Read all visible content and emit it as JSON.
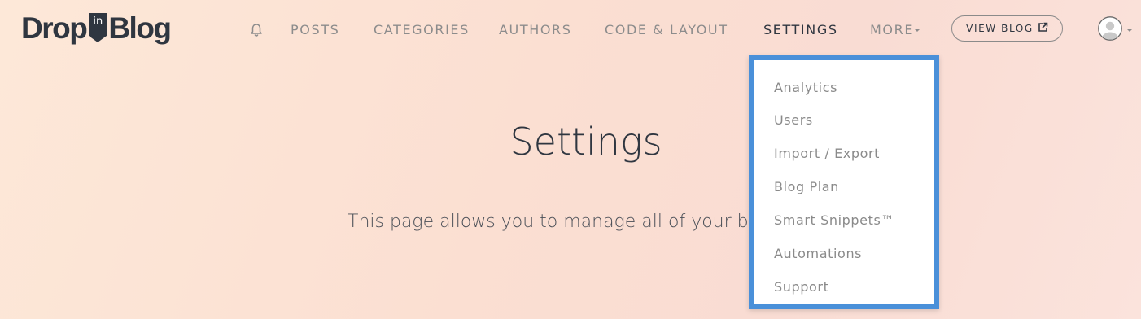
{
  "logo": {
    "part1": "Drop",
    "badge": "in",
    "part2": "Blog"
  },
  "nav": {
    "bell_icon": "bell-icon",
    "items": [
      {
        "label": "POSTS"
      },
      {
        "label": "CATEGORIES"
      },
      {
        "label": "AUTHORS"
      },
      {
        "label": "CODE & LAYOUT"
      },
      {
        "label": "SETTINGS",
        "active": true
      },
      {
        "label": "MORE"
      }
    ],
    "view_blog": "VIEW BLOG",
    "external_link_icon": "external-link-icon",
    "avatar_icon": "user-avatar-icon"
  },
  "main": {
    "title": "Settings",
    "description": "This page allows you to manage all of your blog"
  },
  "dropdown": {
    "items": [
      {
        "label": "Analytics"
      },
      {
        "label": "Users"
      },
      {
        "label": "Import / Export"
      },
      {
        "label": "Blog Plan"
      },
      {
        "label": "Smart Snippets™"
      },
      {
        "label": "Automations"
      },
      {
        "label": "Support"
      }
    ]
  },
  "colors": {
    "text_dark": "#2f3640",
    "text_muted": "#8c8c8c",
    "highlight_border": "#4a90d9",
    "background": "#fbe0d4"
  }
}
